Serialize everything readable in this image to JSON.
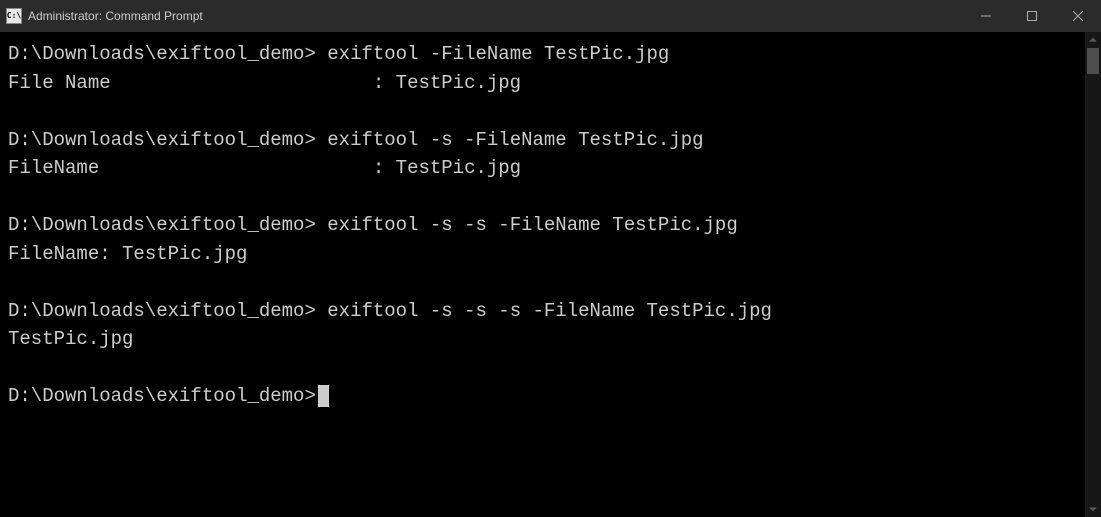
{
  "window": {
    "title": "Administrator: Command Prompt",
    "icon_label": "C:\\"
  },
  "terminal": {
    "lines": [
      {
        "prompt": "D:\\Downloads\\exiftool_demo> ",
        "command": "exiftool -FileName TestPic.jpg"
      },
      {
        "output": "File Name                       : TestPic.jpg"
      },
      {
        "output": ""
      },
      {
        "prompt": "D:\\Downloads\\exiftool_demo> ",
        "command": "exiftool -s -FileName TestPic.jpg"
      },
      {
        "output": "FileName                        : TestPic.jpg"
      },
      {
        "output": ""
      },
      {
        "prompt": "D:\\Downloads\\exiftool_demo> ",
        "command": "exiftool -s -s -FileName TestPic.jpg"
      },
      {
        "output": "FileName: TestPic.jpg"
      },
      {
        "output": ""
      },
      {
        "prompt": "D:\\Downloads\\exiftool_demo> ",
        "command": "exiftool -s -s -s -FileName TestPic.jpg"
      },
      {
        "output": "TestPic.jpg"
      },
      {
        "output": ""
      },
      {
        "prompt": "D:\\Downloads\\exiftool_demo>",
        "command": "",
        "cursor": true
      }
    ]
  }
}
